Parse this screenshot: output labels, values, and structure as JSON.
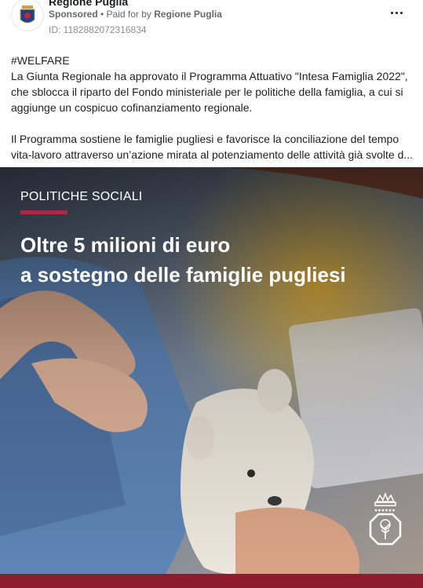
{
  "post": {
    "page_name": "Regione Puglia",
    "sponsored_label": "Sponsored",
    "separator": " • ",
    "paid_for_prefix": "Paid for by ",
    "payer": "Regione Puglia",
    "ad_id": "ID: 1182882072316834",
    "menu_icon": "more-horizontal-icon"
  },
  "body": {
    "hashtag": "#WELFARE",
    "paragraph1": "La Giunta Regionale ha approvato il Programma Attuativo \"Intesa Famiglia 2022\", che sblocca il riparto del Fondo ministeriale per le politiche della famiglia, a cui si aggiunge un cospicuo cofinanziamento regionale.",
    "paragraph2_line1": "Il Programma sostiene le famiglie pugliesi e favorisce la conciliazione del tempo",
    "paragraph2_line2": "vita-lavoro attraverso un’azione mirata al potenziamento delle attività già svolte d..."
  },
  "creative": {
    "tag": "POLITICHE SOCIALI",
    "headline_line1": "Oltre 5 milioni di euro",
    "headline_line2": "a sostegno delle famiglie pugliesi",
    "accent_color": "#b0283d",
    "bar_color": "#8c1c2e"
  }
}
